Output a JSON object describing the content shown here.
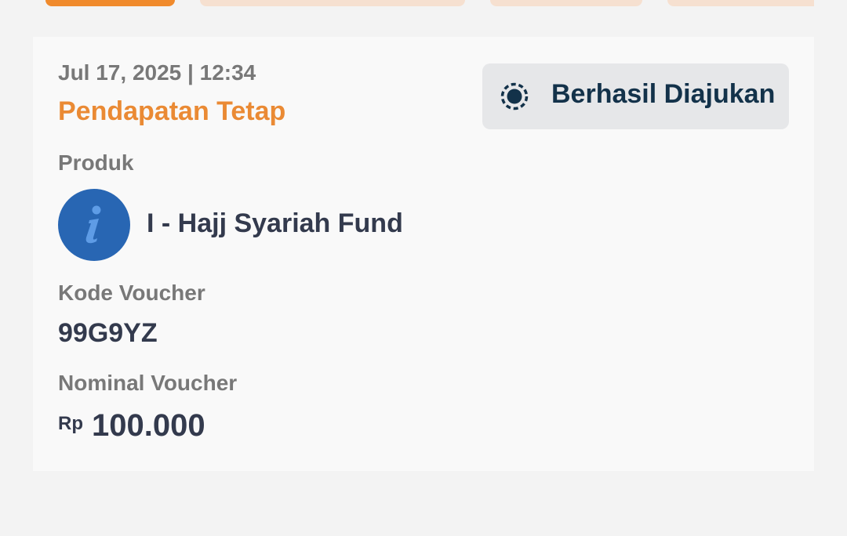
{
  "tabs": [
    {
      "label": "",
      "active": true
    },
    {
      "label": "",
      "active": false
    },
    {
      "label": "",
      "active": false
    },
    {
      "label": "",
      "active": false
    }
  ],
  "transaction": {
    "datetime": "Jul 17, 2025 | 12:34",
    "type": "Pendapatan Tetap",
    "status": {
      "label": "Berhasil Diajukan",
      "icon": "pending-circle-icon"
    },
    "product": {
      "label": "Produk",
      "name": "I - Hajj Syariah Fund",
      "logo_icon": "info-icon"
    },
    "voucher_code": {
      "label": "Kode Voucher",
      "value": "99G9YZ"
    },
    "voucher_nominal": {
      "label": "Nominal Voucher",
      "currency": "Rp",
      "amount": "100.000"
    }
  },
  "colors": {
    "accent": "#f08a2c",
    "accent_light": "#f6e0d0",
    "title_orange": "#ea8a34",
    "label_gray": "#787878",
    "text_dark": "#333a4d",
    "status_text": "#13324a",
    "logo_blue": "#2866b3"
  }
}
